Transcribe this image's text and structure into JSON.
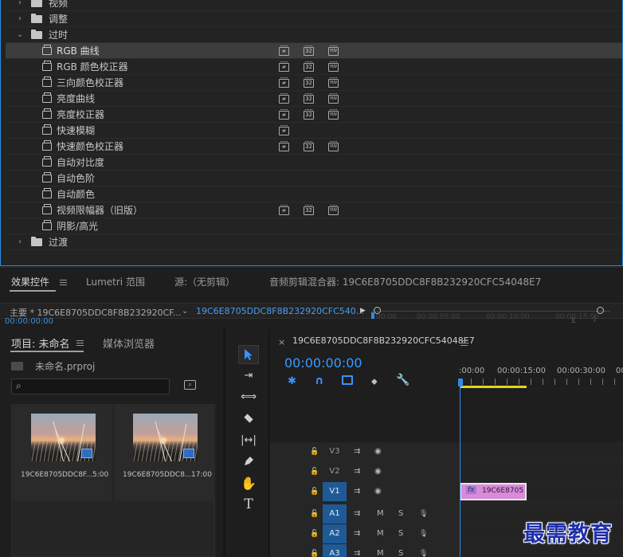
{
  "effects_tree": {
    "rows": [
      {
        "type": "folder",
        "open": false,
        "label": "视频"
      },
      {
        "type": "folder",
        "open": false,
        "label": "调整"
      },
      {
        "type": "folder",
        "open": true,
        "label": "过时"
      },
      {
        "type": "effect",
        "label": "RGB 曲线",
        "selected": true,
        "badges": [
          "accel",
          "32",
          "yuv"
        ]
      },
      {
        "type": "effect",
        "label": "RGB 颜色校正器",
        "badges": [
          "accel",
          "32",
          "yuv"
        ]
      },
      {
        "type": "effect",
        "label": "三向颜色校正器",
        "badges": [
          "accel",
          "32",
          "yuv"
        ]
      },
      {
        "type": "effect",
        "label": "亮度曲线",
        "badges": [
          "accel",
          "32",
          "yuv"
        ]
      },
      {
        "type": "effect",
        "label": "亮度校正器",
        "badges": [
          "accel",
          "32",
          "yuv"
        ]
      },
      {
        "type": "effect",
        "label": "快速模糊",
        "badges": [
          "accel"
        ]
      },
      {
        "type": "effect",
        "label": "快速颜色校正器",
        "badges": [
          "accel",
          "32",
          "yuv"
        ]
      },
      {
        "type": "effect",
        "label": "自动对比度",
        "badges": []
      },
      {
        "type": "effect",
        "label": "自动色阶",
        "badges": []
      },
      {
        "type": "effect",
        "label": "自动颜色",
        "badges": []
      },
      {
        "type": "effect",
        "label": "视频限幅器（旧版）",
        "badges": [
          "accel",
          "32",
          "yuv"
        ]
      },
      {
        "type": "effect",
        "label": "阴影/高光",
        "badges": []
      },
      {
        "type": "folder",
        "open": false,
        "label": "过渡"
      }
    ],
    "badge_text": {
      "accel": "⇄",
      "32": "32",
      "yuv": "YUV"
    }
  },
  "effect_controls": {
    "tabs": [
      {
        "label": "效果控件",
        "active": true
      },
      {
        "label": "Lumetri 范围"
      },
      {
        "label": "源:（无剪辑）"
      },
      {
        "label": "音频剪辑混合器: 19C6E8705DDC8F8B232920CFC54048E7"
      }
    ],
    "master_label": "主要 * 19C6E8705DDC8F8B232920CF...",
    "sequence_label": "19C6E8705DDC8F8B232920CFC540...",
    "play_icon": "play-triangle-icon",
    "ruler_ticks": [
      "00:00",
      "00:00:05:00",
      "00:00:10:00",
      "00:00:15:00"
    ],
    "timecode": "00:00:00:00"
  },
  "project": {
    "tabs": [
      {
        "label": "项目: 未命名",
        "active": true
      },
      {
        "label": "媒体浏览器"
      }
    ],
    "file": "未命名.prproj",
    "clips": [
      {
        "name": "19C6E8705DDC8F...",
        "duration": "5:00",
        "badge": "film-strip-icon"
      },
      {
        "name": "19C6E8705DDC8...",
        "duration": "17:00",
        "badge": "sequence-icon"
      }
    ]
  },
  "tools": [
    "selection-tool-icon",
    "track-select-tool-icon",
    "ripple-edit-tool-icon",
    "razor-tool-icon",
    "slip-tool-icon",
    "pen-tool-icon",
    "hand-tool-icon",
    "type-tool-icon"
  ],
  "timeline": {
    "sequence_name": "19C6E8705DDC8F8B232920CFC54048E7",
    "timecode": "00:00:00:00",
    "ruler_ticks": [
      ":00:00",
      "00:00:15:00",
      "00:00:30:00",
      "00"
    ],
    "tracks": [
      {
        "name": "V3",
        "kind": "video",
        "targeted": false
      },
      {
        "name": "V2",
        "kind": "video",
        "targeted": false
      },
      {
        "name": "V1",
        "kind": "video",
        "targeted": true
      },
      {
        "name": "A1",
        "kind": "audio",
        "targeted": true
      },
      {
        "name": "A2",
        "kind": "audio",
        "targeted": true
      },
      {
        "name": "A3",
        "kind": "audio",
        "targeted": true
      }
    ],
    "clip_label": "19C6E8705",
    "clip_fx": "fx",
    "audio_m": "M",
    "audio_s": "S"
  },
  "colors": {
    "accent": "#2d8ceb",
    "clip_pink": "#d98ad9",
    "work_area": "#e8d21d",
    "targeted": "#1e5a96"
  },
  "watermark": "最需教育"
}
